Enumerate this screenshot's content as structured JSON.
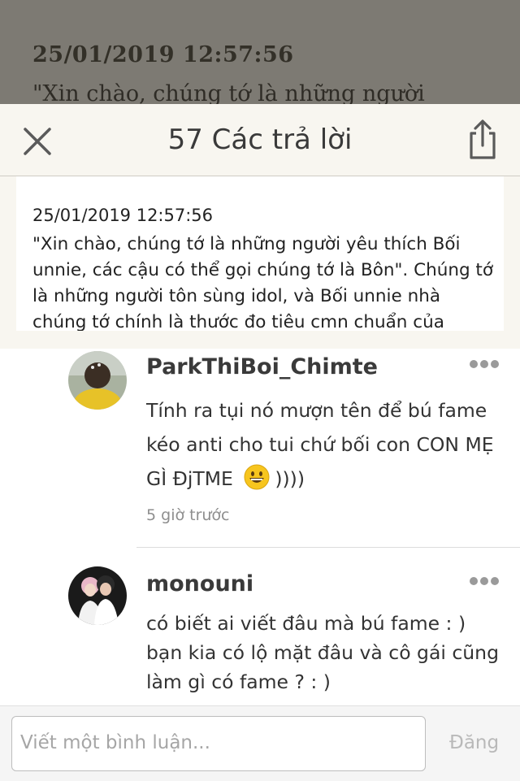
{
  "background": {
    "date": "25/01/2019 12:57:56",
    "text": "\"Xin chào, chúng tớ là những người"
  },
  "header": {
    "title": "57 Các trả lời"
  },
  "quote": {
    "date": "25/01/2019 12:57:56",
    "body": "\"Xin chào, chúng tớ là những người yêu thích Bối unnie, các cậu có thể gọi chúng tớ là Bôn\". Chúng tớ là những người tôn sùng idol, và Bối unnie nhà chúng tớ chính là thước đo tiêu cmn chuẩn của"
  },
  "comments": [
    {
      "username": "ParkThiBoi_Chimte",
      "text_before_emoji": "Tính ra tụi nó mượn tên để bú fame kéo anti cho tui chứ bối con CON MẸ GÌ ĐjTME",
      "text_after_emoji": "))))",
      "time": "5 giờ trước"
    },
    {
      "username": "monouni",
      "text": "có biết ai viết đâu mà bú fame : ) bạn kia có lộ mặt đâu và cô gái cũng làm gì có fame ? : )"
    }
  ],
  "composer": {
    "placeholder": "Viết một bình luận...",
    "post_label": "Đăng"
  },
  "icons": {
    "close": "close-icon",
    "share": "share-icon",
    "more": "more-dots-icon",
    "emoji": "grinning-face-emoji"
  },
  "colors": {
    "sheet_background": "#f8f6f0",
    "dim_background": "#7d7a73",
    "muted_text": "#8e8e8e"
  }
}
